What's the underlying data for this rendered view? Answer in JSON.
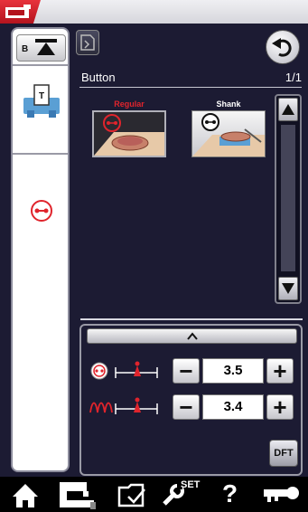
{
  "screen": {
    "title": "Button",
    "page_indicator": "1/1"
  },
  "left_panel": {
    "bobbin_label": "B"
  },
  "stitches": [
    {
      "label": "Regular",
      "label_color": "#e0242c",
      "selected": true
    },
    {
      "label": "Shank",
      "label_color": "#ffffff",
      "selected": false
    }
  ],
  "settings": {
    "width": {
      "value": "3.5"
    },
    "length": {
      "value": "3.4"
    },
    "dft_label": "DFT"
  },
  "bottom_nav": {
    "set_label": "SET",
    "help_label": "?"
  },
  "colors": {
    "accent_red": "#e0242c",
    "background": "#1c1b33"
  }
}
